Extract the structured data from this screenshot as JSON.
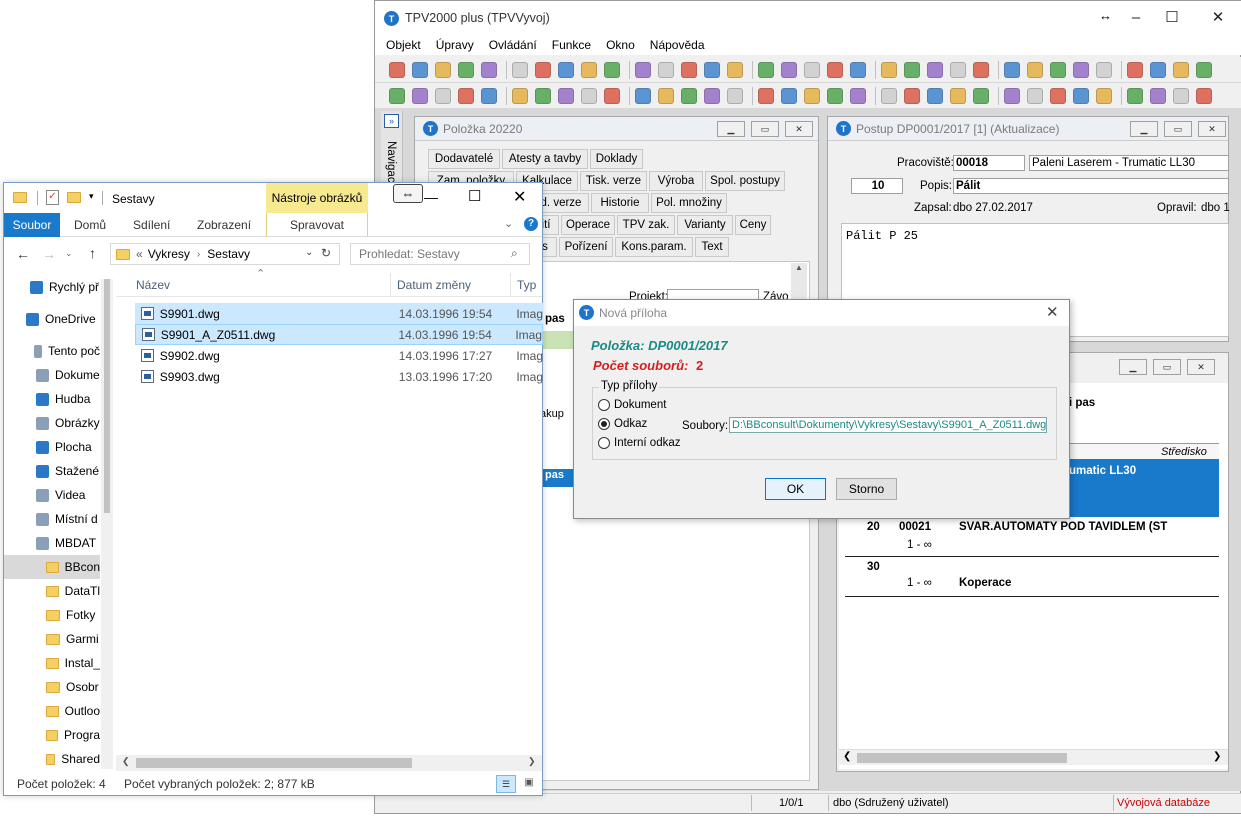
{
  "tpv": {
    "title": "TPV2000 plus (TPVVyvoj)",
    "logo": "T",
    "menu": [
      "Objekt",
      "Úpravy",
      "Ovládání",
      "Funkce",
      "Okno",
      "Nápověda"
    ],
    "nav_label": "Navigace",
    "status": {
      "position": "1/0/1",
      "user": "dbo (Sdružený uživatel)",
      "database": "Vývojová databáze"
    },
    "toolbar_colors": [
      "#d9462f",
      "#2a76c9",
      "#e3a72c",
      "#3b9a3b",
      "#8a5cc2",
      "#c8c8c8"
    ]
  },
  "polozka": {
    "title": "Položka 20220",
    "tabs_row1": [
      "Dodavatelé",
      "Atesty a tavby",
      "Doklady"
    ],
    "tabs_row2": [
      "Zam. položky",
      "Kalkulace",
      "Tisk. verze",
      "Výroba",
      "Spol. postupy"
    ],
    "tabs_row3": [
      "d. verze",
      "Historie",
      "Pol. množiny"
    ],
    "tabs_row4": [
      "ití",
      "Operace",
      "TPV zak.",
      "Varianty",
      "Ceny"
    ],
    "tabs_row5": [
      "s",
      "Pořízení",
      "Kons.param.",
      "Text"
    ],
    "projekt_label": "Projekt:",
    "zavod_label": "Závo",
    "frag_pas1": "pas",
    "frag_kup": "akup",
    "frag_pas2": "pas"
  },
  "postup": {
    "title": "Postup DP0001/2017  [1] (Aktualizace)",
    "pracoviste_label": "Pracoviště:",
    "pracoviste_value": "00018",
    "pracoviste_name": "Paleni Laserem - Trumatic LL30",
    "cislo": "10",
    "popis_label": "Popis:",
    "popis_value": "Pálit",
    "zapsal_label": "Zapsal:",
    "zapsal_value": "dbo 27.02.2017",
    "opravil_label": "Opravil:",
    "opravil_value": "dbo 1",
    "text": "Pálit P 25"
  },
  "second": {
    "frag_pas": "i pas",
    "col_stredisko": "Středisko",
    "sel_text": "umatic LL30",
    "rows": [
      {
        "op": "20",
        "code": "00021",
        "desc": "SVAR.AUTOMATY POD TAVIDLEM (ST",
        "qty": "1 - ∞"
      },
      {
        "op": "30",
        "code": "",
        "desc": "Koperace",
        "qty": "1 - ∞"
      }
    ]
  },
  "dialog": {
    "title": "Nová příloha",
    "polozka": "Položka: DP0001/2017",
    "pocet": "Počet souborů:",
    "pocet_value": "2",
    "group": "Typ přílohy",
    "options": [
      "Dokument",
      "Odkaz",
      "Interní odkaz"
    ],
    "selected": "Odkaz",
    "soubory_label": "Soubory:",
    "soubory_value": "D:\\BBconsult\\Dokumenty\\Vykresy\\Sestavy\\S9901_A_Z0511.dwg",
    "ok": "OK",
    "storno": "Storno"
  },
  "explorer": {
    "title": "Sestavy",
    "context_tab": "Nástroje obrázků",
    "context_sub": "Spravovat",
    "ribbon_tabs": [
      "Soubor",
      "Domů",
      "Sdílení",
      "Zobrazení"
    ],
    "path": [
      "Vykresy",
      "Sestavy"
    ],
    "path_prefix": "«",
    "search_placeholder": "Prohledat: Sestavy",
    "columns": {
      "name": "Název",
      "date": "Datum změny",
      "type": "Typ"
    },
    "files": [
      {
        "name": "S9901.dwg",
        "date": "14.03.1996 19:54",
        "type": "Imag",
        "selected": true
      },
      {
        "name": "S9901_A_Z0511.dwg",
        "date": "14.03.1996 19:54",
        "type": "Imag",
        "selected": true
      },
      {
        "name": "S9902.dwg",
        "date": "14.03.1996 17:27",
        "type": "Imag",
        "selected": false
      },
      {
        "name": "S9903.dwg",
        "date": "13.03.1996 17:20",
        "type": "Imag",
        "selected": false
      }
    ],
    "nav": [
      "Rychlý př",
      "OneDrive",
      "Tento poč",
      "Dokume",
      "Hudba",
      "Obrázky",
      "Plocha",
      "Stažené",
      "Videa",
      "Místní d",
      "MBDAT",
      "BBcon",
      "DataTl",
      "Fotky",
      "Garmi",
      "Instal_",
      "Osobr",
      "Outloo",
      "Progra",
      "Shared"
    ],
    "status_count": "Počet položek: 4",
    "status_selected": "Počet vybraných položek: 2; 877 kB",
    "colors": {
      "accent": "#1979ca",
      "selected": "#cce8ff",
      "context": "#f6e98f"
    }
  }
}
